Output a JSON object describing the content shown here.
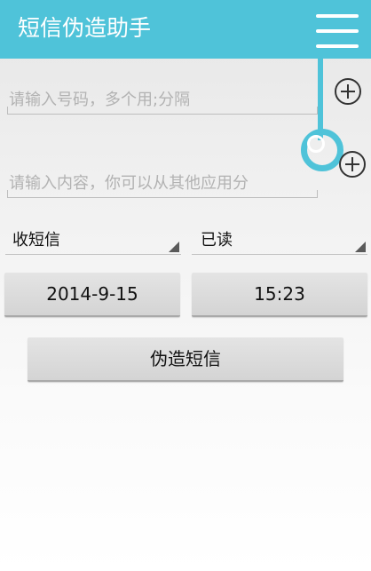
{
  "header": {
    "title": "短信伪造助手",
    "menu_icon": "menu-icon"
  },
  "form": {
    "number_placeholder": "请输入号码，多个用;分隔",
    "content_placeholder": "请输入内容，你可以从其他应用分",
    "add_icon": "plus-circle-icon"
  },
  "spinners": {
    "type_value": "收短信",
    "status_value": "已读"
  },
  "datetime": {
    "date": "2014-9-15",
    "time": "15:23"
  },
  "actions": {
    "forge_label": "伪造短信"
  },
  "colors": {
    "accent": "#4fc3d9"
  }
}
